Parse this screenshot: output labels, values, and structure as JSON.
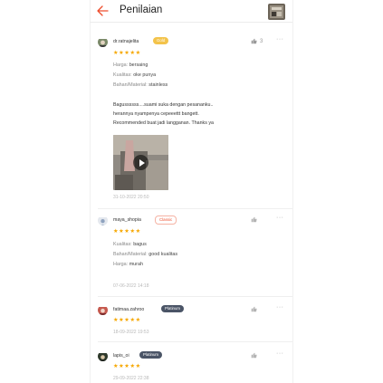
{
  "header": {
    "title": "Penilaian"
  },
  "colors": {
    "accent": "#ee4d2d",
    "star": "#f6a700",
    "gold_badge": "#f3c34a",
    "platinum_badge": "#4a5466"
  },
  "reviews": [
    {
      "username": "dr.ratnajelita",
      "badge": "Gold",
      "likes": "3",
      "rating": 5,
      "stars": "★★★★★",
      "attrs": [
        {
          "key": "Harga:",
          "value": "bersaing"
        },
        {
          "key": "Kualitas:",
          "value": "oke punya"
        },
        {
          "key": "Bahan/Material:",
          "value": "stainless"
        }
      ],
      "text_lines": [
        "Bagussssss....suami suka dengan pesananku..",
        "herannya nyampenya cepeeettt bangett.",
        "Recommended buat jadi langganan. Thanks ya"
      ],
      "media": "video-thumbnail",
      "date": "31-10-2022 20:50"
    },
    {
      "username": "maya_shopia",
      "badge": "Classic",
      "likes": "",
      "rating": 5,
      "stars": "★★★★★",
      "attrs": [
        {
          "key": "Kualitas:",
          "value": "bagus"
        },
        {
          "key": "Bahan/Material:",
          "value": "good kualitas"
        },
        {
          "key": "Harga:",
          "value": "murah"
        }
      ],
      "date": "07-06-2022 14:18"
    },
    {
      "username": "fatimaa.zahroo",
      "badge": "Platinum",
      "likes": "",
      "rating": 5,
      "stars": "★★★★★",
      "date": "18-09-2022 19:53"
    },
    {
      "username": "lapis_oi",
      "badge": "Platinum",
      "likes": "",
      "rating": 5,
      "stars": "★★★★★",
      "date": "29-09-2022 22:38"
    }
  ],
  "icons": {
    "back": "arrow-left-icon",
    "like": "thumbs-up-icon",
    "more": "more-dots-icon",
    "play": "play-icon"
  }
}
